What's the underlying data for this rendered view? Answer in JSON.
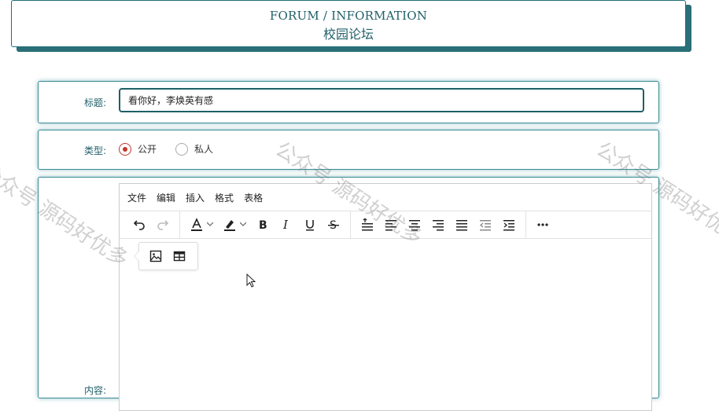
{
  "header": {
    "title_en": "FORUM / INFORMATION",
    "title_cn": "校园论坛"
  },
  "form": {
    "title_label": "标题:",
    "title_value": "看你好，李焕英有感",
    "type_label": "类型:",
    "type_options": [
      {
        "label": "公开",
        "checked": true
      },
      {
        "label": "私人",
        "checked": false
      }
    ],
    "content_label": "内容:"
  },
  "editor": {
    "menu": [
      "文件",
      "编辑",
      "插入",
      "格式",
      "表格"
    ],
    "toolbar_icons": [
      "undo-icon",
      "redo-icon",
      "text-color-icon",
      "highlight-icon",
      "bold-icon",
      "italic-icon",
      "underline-icon",
      "strikethrough-icon",
      "line-height-icon",
      "align-left-icon",
      "align-center-icon",
      "align-right-icon",
      "align-justify-icon",
      "outdent-icon",
      "indent-icon",
      "more-icon"
    ],
    "quick_insert_icons": [
      "image-icon",
      "table-icon"
    ]
  },
  "watermark": {
    "text": "公众号 源码好优多"
  },
  "colors": {
    "accent": "#1f5f68",
    "radio_selected": "#c0392b"
  }
}
